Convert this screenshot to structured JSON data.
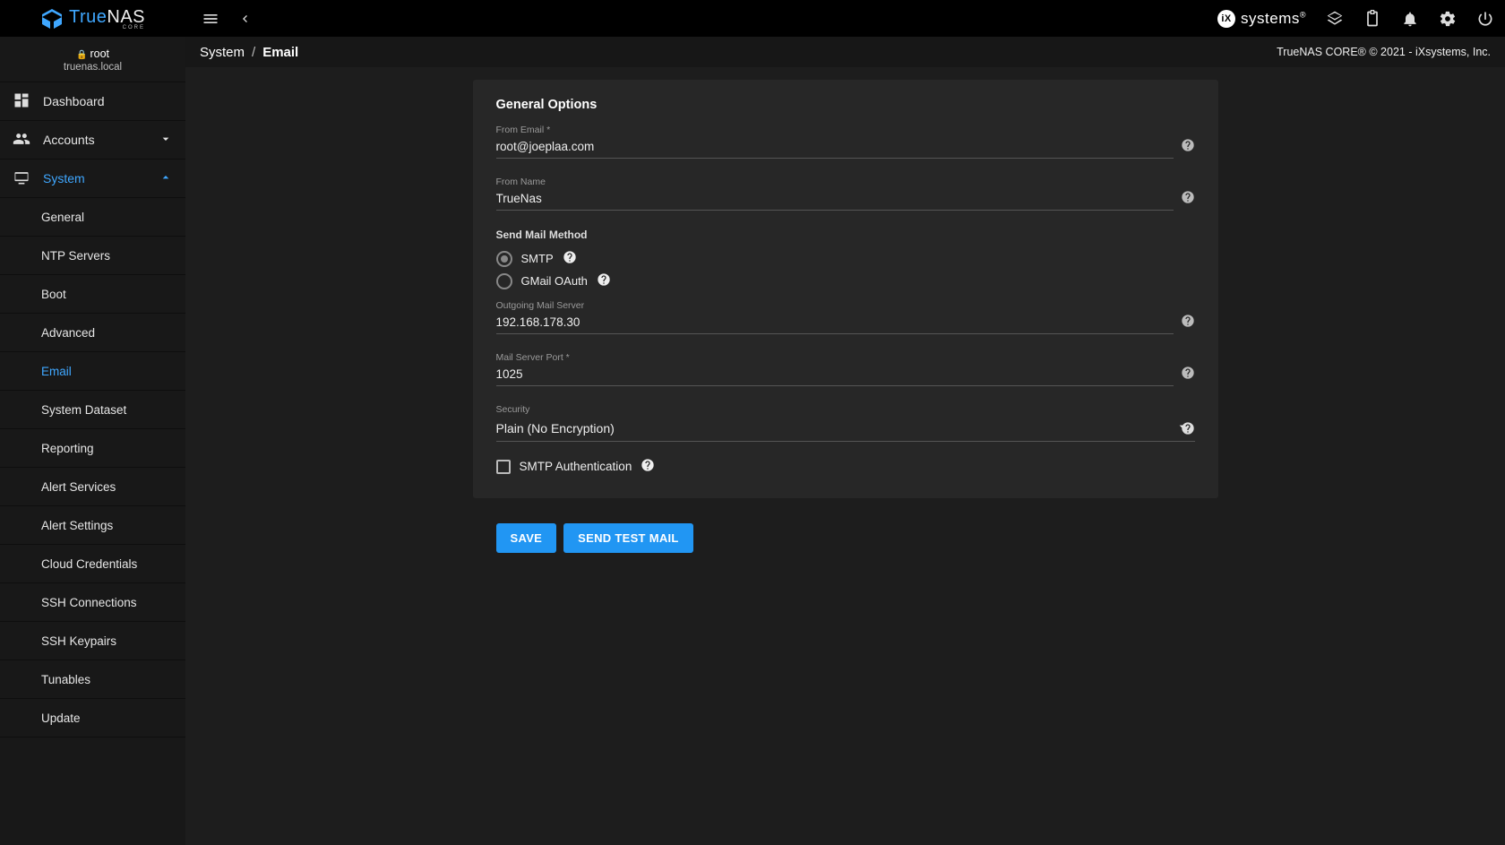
{
  "brand": {
    "true": "True",
    "nas": "NAS",
    "sub": "CORE"
  },
  "ix": {
    "prefix": "iX",
    "word": "systems"
  },
  "host": {
    "user": "root",
    "hostname": "truenas.local"
  },
  "breadcrumb": {
    "root": "System",
    "leaf": "Email"
  },
  "copyright": "TrueNAS CORE® © 2021 - iXsystems, Inc.",
  "nav": {
    "dashboard": "Dashboard",
    "accounts": "Accounts",
    "system": "System"
  },
  "system_children": {
    "general": "General",
    "ntp": "NTP Servers",
    "boot": "Boot",
    "advanced": "Advanced",
    "email": "Email",
    "sysdataset": "System Dataset",
    "reporting": "Reporting",
    "alertsvc": "Alert Services",
    "alertset": "Alert Settings",
    "cloud": "Cloud Credentials",
    "sshconn": "SSH Connections",
    "sshkeys": "SSH Keypairs",
    "tunables": "Tunables",
    "update": "Update"
  },
  "form": {
    "title": "General Options",
    "from_email_label": "From Email *",
    "from_email_value": "root@joeplaa.com",
    "from_name_label": "From Name",
    "from_name_value": "TrueNas",
    "send_method_label": "Send Mail Method",
    "smtp_label": "SMTP",
    "gmail_label": "GMail OAuth",
    "outgoing_label": "Outgoing Mail Server",
    "outgoing_value": "192.168.178.30",
    "port_label": "Mail Server Port *",
    "port_value": "1025",
    "security_label": "Security",
    "security_value": "Plain (No Encryption)",
    "smtp_auth_label": "SMTP Authentication",
    "save": "Save",
    "send_test": "Send Test Mail"
  }
}
